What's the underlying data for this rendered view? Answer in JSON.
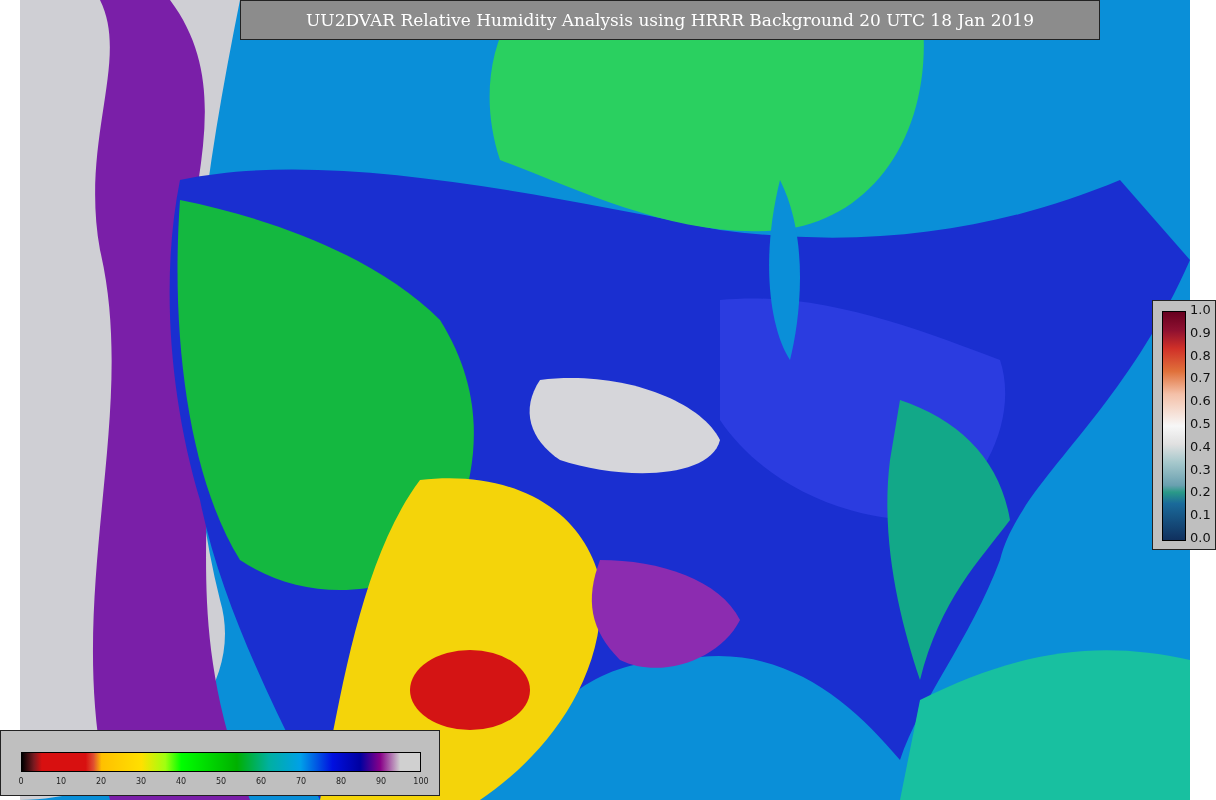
{
  "title": "UU2DVAR Relative Humidity Analysis using HRRR Background 20 UTC 18 Jan 2019",
  "station_legend": {
    "ticks": [
      "1.0",
      "0.9",
      "0.8",
      "0.7",
      "0.6",
      "0.5",
      "0.4",
      "0.3",
      "0.2",
      "0.1",
      "0.0"
    ]
  },
  "humidity_legend": {
    "ticks": [
      "0",
      "10",
      "20",
      "30",
      "40",
      "50",
      "60",
      "70",
      "80",
      "90",
      "100"
    ]
  }
}
